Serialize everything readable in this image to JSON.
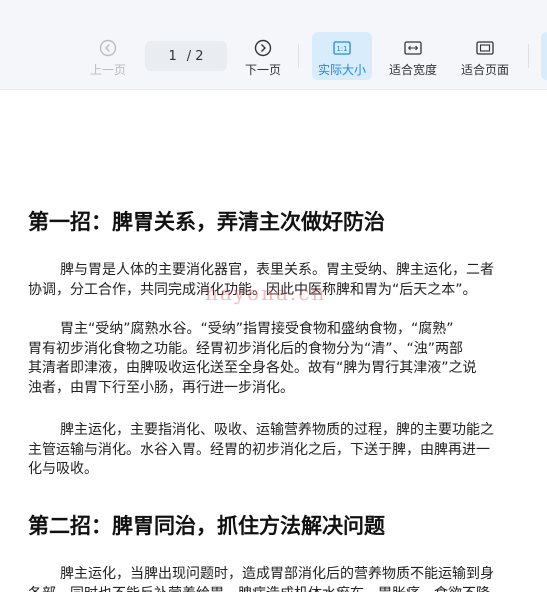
{
  "toolbar": {
    "prev_label": "上一页",
    "next_label": "下一页",
    "current_page": "1",
    "page_separator": "/",
    "total_pages": "2",
    "actual_size_label": "实际大小",
    "fit_width_label": "适合宽度",
    "fit_page_label": "适合页面",
    "accent_color": "#1e8be0"
  },
  "document": {
    "heading1": "第一招：脾胃关系，弄清主次做好防治",
    "p1": "脾与胃是人体的主要消化器官，表里关系。胃主受纳、脾主运化，二者\n协调，分工合作，共同完成消化功能。因此中医称脾和胃为“后天之本”。",
    "p2": "胃主“受纳”腐熟水谷。“受纳”指胃接受食物和盛纳食物，“腐熟”\n胃有初步消化食物之功能。经胃初步消化后的食物分为“清”、“浊”两部\n其清者即津液，由脾吸收运化送至全身各处。故有“脾为胃行其津液”之说\n浊者，由胃下行至小肠，再行进一步消化。",
    "p3": "脾主运化，主要指消化、吸收、运输营养物质的过程，脾的主要功能之\n主管运输与消化。水谷入胃。经胃的初步消化之后，下送于脾，由脾再进一\n化与吸收。",
    "heading2": "第二招：脾胃同治，抓住方法解决问题",
    "p4": "脾主运化，当脾出现问题时，造成胃部消化后的营养物质不能运输到身\n各部，同时也不能反补营养给胃，脾病造成机体水瘀布，胃胀痛，食欲不降"
  },
  "watermark": "nayona.cn"
}
